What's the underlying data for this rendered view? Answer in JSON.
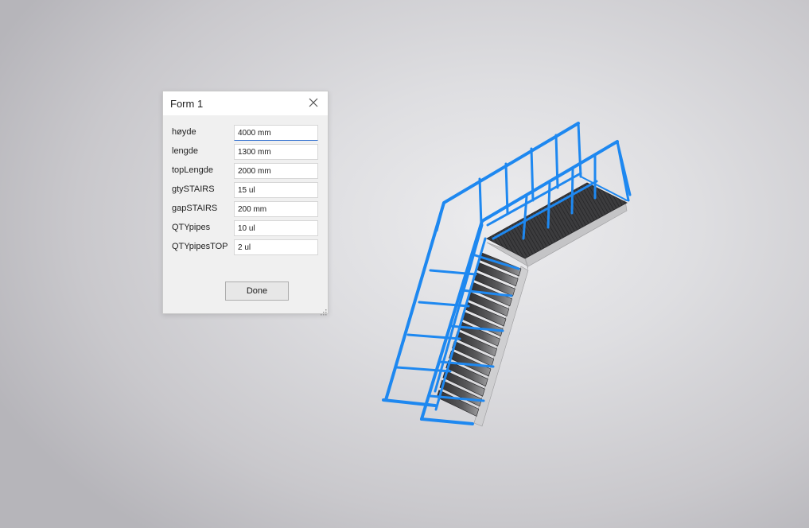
{
  "dialog": {
    "title": "Form 1",
    "params": [
      {
        "label": "høyde",
        "value": "4000 mm"
      },
      {
        "label": "lengde",
        "value": "1300 mm"
      },
      {
        "label": "topLengde",
        "value": "2000 mm"
      },
      {
        "label": "gtySTAIRS",
        "value": "15 ul"
      },
      {
        "label": "gapSTAIRS",
        "value": "200 mm"
      },
      {
        "label": "QTYpipes",
        "value": "10 ul"
      },
      {
        "label": "QTYpipesTOP",
        "value": "2 ul"
      }
    ],
    "done_label": "Done"
  },
  "colors": {
    "railing": "#1e88f0",
    "railing_dark": "#1565c8",
    "tread_dark": "#3a3a3c",
    "stringer": "#bdbdbd"
  },
  "icons": {
    "close": "close-icon",
    "resize": "resize-grip-icon"
  }
}
